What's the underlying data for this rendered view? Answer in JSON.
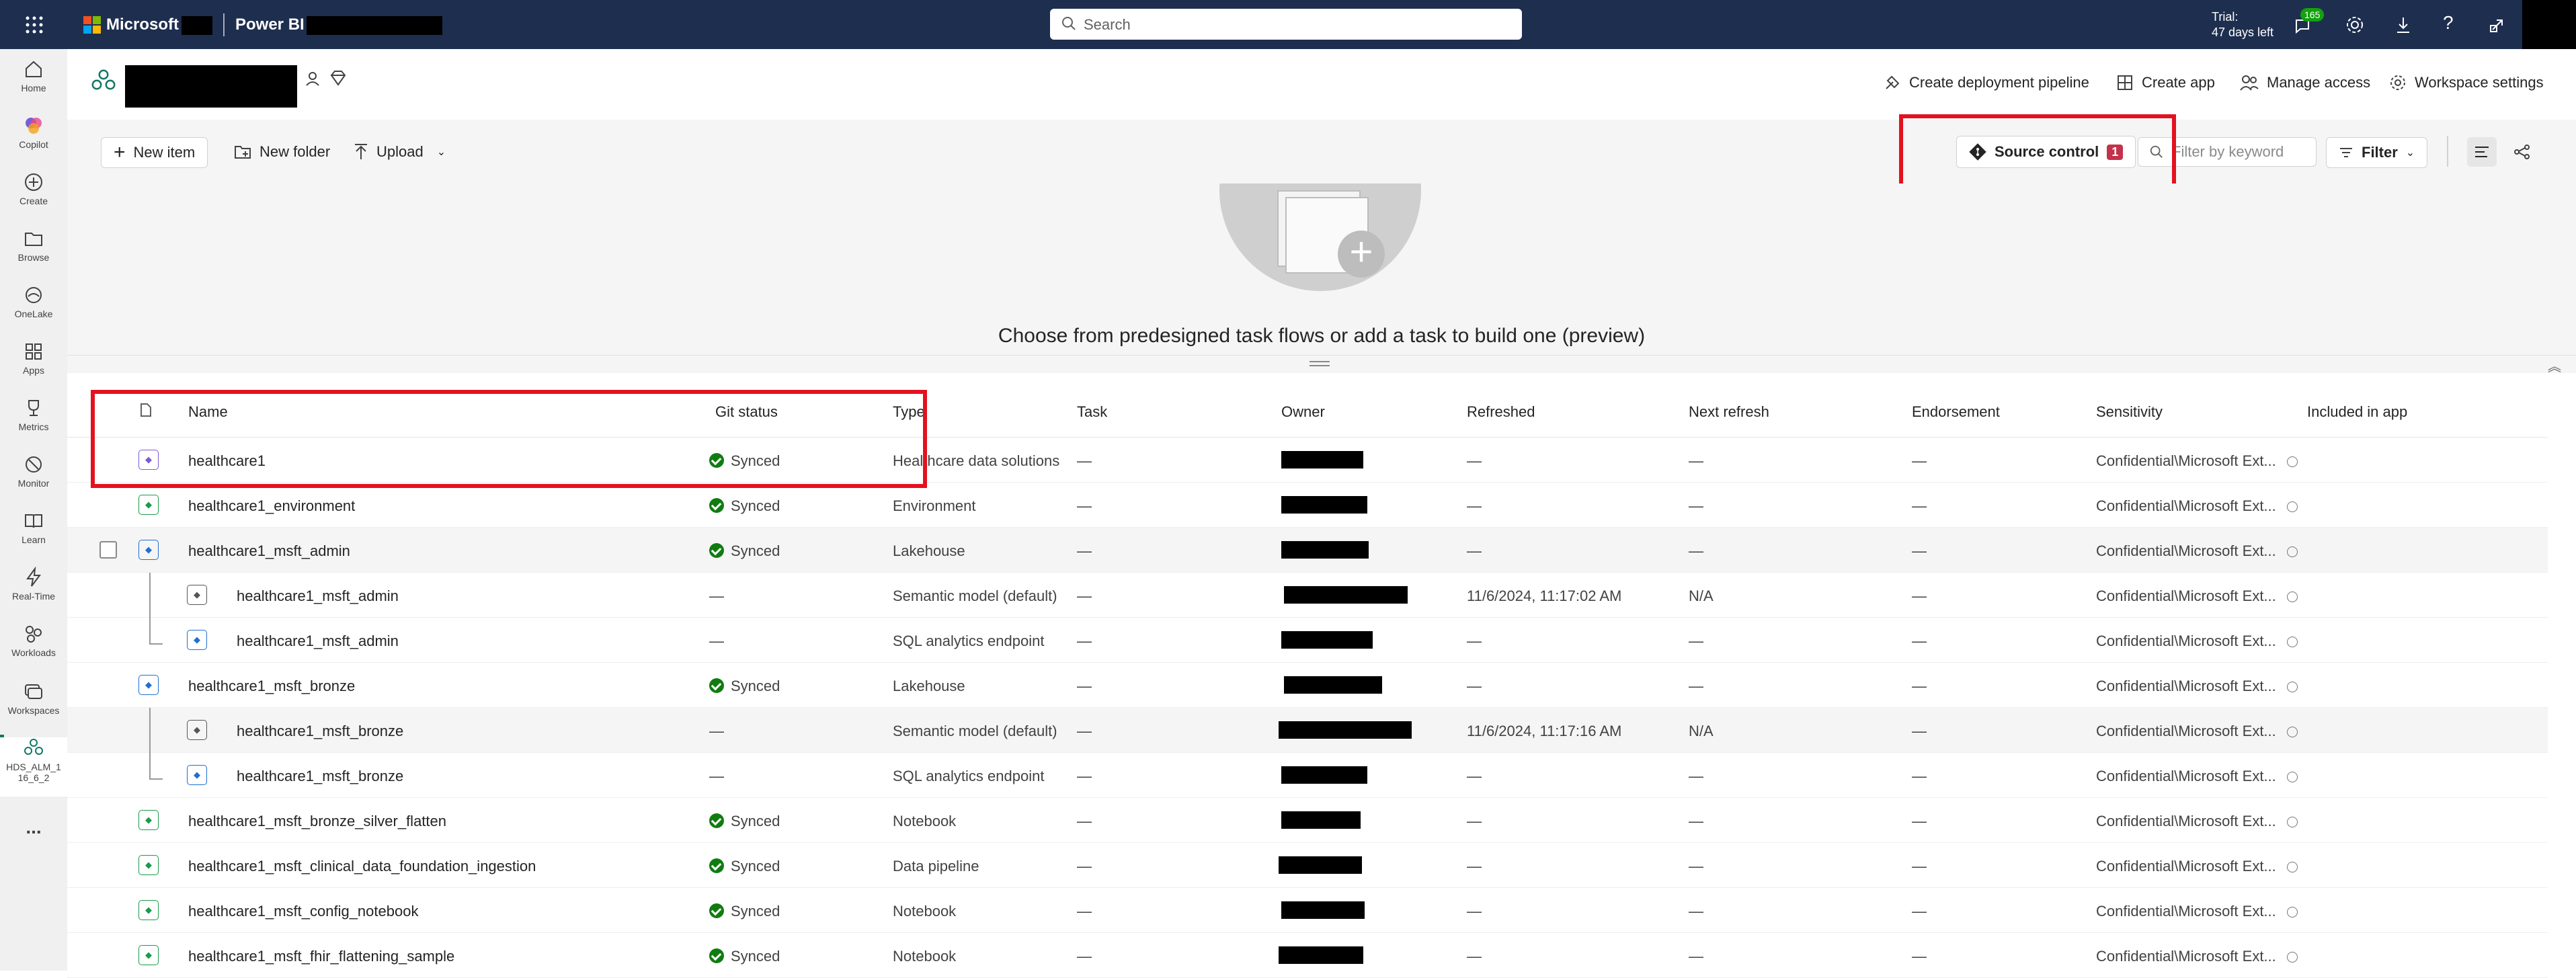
{
  "topbar": {
    "brand": "Microsoft",
    "app": "Power BI",
    "search_placeholder": "Search",
    "trial_line1": "Trial:",
    "trial_line2": "47 days left",
    "notifications_count": "165"
  },
  "rail": {
    "items": [
      {
        "label": "Home",
        "icon": "home-icon"
      },
      {
        "label": "Copilot",
        "icon": "copilot-icon"
      },
      {
        "label": "Create",
        "icon": "create-icon"
      },
      {
        "label": "Browse",
        "icon": "browse-icon"
      },
      {
        "label": "OneLake",
        "icon": "onelake-icon"
      },
      {
        "label": "Apps",
        "icon": "apps-icon"
      },
      {
        "label": "Metrics",
        "icon": "metrics-icon"
      },
      {
        "label": "Monitor",
        "icon": "monitor-icon"
      },
      {
        "label": "Learn",
        "icon": "learn-icon"
      },
      {
        "label": "Real-Time",
        "icon": "realtime-icon"
      },
      {
        "label": "Workloads",
        "icon": "workloads-icon"
      },
      {
        "label": "Workspaces",
        "icon": "workspaces-icon"
      }
    ],
    "active_workspace": {
      "line1": "HDS_ALM_1",
      "line2": "16_6_2"
    },
    "more": "..."
  },
  "header": {
    "actions": [
      {
        "label": "Create deployment pipeline",
        "icon": "pipeline-icon"
      },
      {
        "label": "Create app",
        "icon": "app-icon"
      },
      {
        "label": "Manage access",
        "icon": "people-icon"
      },
      {
        "label": "Workspace settings",
        "icon": "gear-icon"
      }
    ]
  },
  "toolbar": {
    "new_item": "New item",
    "new_folder": "New folder",
    "upload": "Upload",
    "source_control": "Source control",
    "source_control_badge": "1",
    "filter_placeholder": "Filter by keyword",
    "filter": "Filter"
  },
  "taskflow": {
    "message": "Choose from predesigned task flows or add a task to build one (preview)"
  },
  "table": {
    "columns": [
      "Name",
      "Git status",
      "Type",
      "Task",
      "Owner",
      "Refreshed",
      "Next refresh",
      "Endorsement",
      "Sensitivity",
      "Included in app"
    ],
    "rows": [
      {
        "name": "healthcare1",
        "git": "Synced",
        "type": "Healthcare data solutions",
        "task": "—",
        "refreshed": "—",
        "next": "—",
        "endorse": "—",
        "sens": "Confidential\\Microsoft Ext...",
        "child": false,
        "icon": "healthcare-icon"
      },
      {
        "name": "healthcare1_environment",
        "git": "Synced",
        "type": "Environment",
        "task": "—",
        "refreshed": "—",
        "next": "—",
        "endorse": "—",
        "sens": "Confidential\\Microsoft Ext...",
        "child": false,
        "icon": "environment-icon"
      },
      {
        "name": "healthcare1_msft_admin",
        "git": "Synced",
        "type": "Lakehouse",
        "task": "—",
        "refreshed": "—",
        "next": "—",
        "endorse": "—",
        "sens": "Confidential\\Microsoft Ext...",
        "child": false,
        "icon": "lakehouse-icon"
      },
      {
        "name": "healthcare1_msft_admin",
        "git": "—",
        "type": "Semantic model (default)",
        "task": "—",
        "refreshed": "11/6/2024, 11:17:02 AM",
        "next": "N/A",
        "endorse": "—",
        "sens": "Confidential\\Microsoft Ext...",
        "child": true,
        "icon": "semantic-model-icon"
      },
      {
        "name": "healthcare1_msft_admin",
        "git": "—",
        "type": "SQL analytics endpoint",
        "task": "—",
        "refreshed": "—",
        "next": "—",
        "endorse": "—",
        "sens": "Confidential\\Microsoft Ext...",
        "child": true,
        "icon": "sql-endpoint-icon"
      },
      {
        "name": "healthcare1_msft_bronze",
        "git": "Synced",
        "type": "Lakehouse",
        "task": "—",
        "refreshed": "—",
        "next": "—",
        "endorse": "—",
        "sens": "Confidential\\Microsoft Ext...",
        "child": false,
        "icon": "lakehouse-icon"
      },
      {
        "name": "healthcare1_msft_bronze",
        "git": "—",
        "type": "Semantic model (default)",
        "task": "—",
        "refreshed": "11/6/2024, 11:17:16 AM",
        "next": "N/A",
        "endorse": "—",
        "sens": "Confidential\\Microsoft Ext...",
        "child": true,
        "icon": "semantic-model-icon"
      },
      {
        "name": "healthcare1_msft_bronze",
        "git": "—",
        "type": "SQL analytics endpoint",
        "task": "—",
        "refreshed": "—",
        "next": "—",
        "endorse": "—",
        "sens": "Confidential\\Microsoft Ext...",
        "child": true,
        "icon": "sql-endpoint-icon"
      },
      {
        "name": "healthcare1_msft_bronze_silver_flatten",
        "git": "Synced",
        "type": "Notebook",
        "task": "—",
        "refreshed": "—",
        "next": "—",
        "endorse": "—",
        "sens": "Confidential\\Microsoft Ext...",
        "child": false,
        "icon": "notebook-icon"
      },
      {
        "name": "healthcare1_msft_clinical_data_foundation_ingestion",
        "git": "Synced",
        "type": "Data pipeline",
        "task": "—",
        "refreshed": "—",
        "next": "—",
        "endorse": "—",
        "sens": "Confidential\\Microsoft Ext...",
        "child": false,
        "icon": "pipeline-icon"
      },
      {
        "name": "healthcare1_msft_config_notebook",
        "git": "Synced",
        "type": "Notebook",
        "task": "—",
        "refreshed": "—",
        "next": "—",
        "endorse": "—",
        "sens": "Confidential\\Microsoft Ext...",
        "child": false,
        "icon": "notebook-icon"
      },
      {
        "name": "healthcare1_msft_fhir_flattening_sample",
        "git": "Synced",
        "type": "Notebook",
        "task": "—",
        "refreshed": "—",
        "next": "—",
        "endorse": "—",
        "sens": "Confidential\\Microsoft Ext...",
        "child": false,
        "icon": "notebook-icon"
      }
    ]
  }
}
